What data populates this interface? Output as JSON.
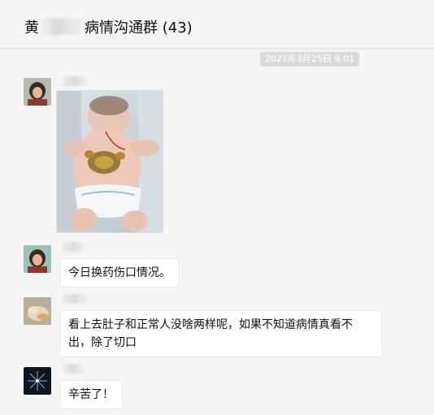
{
  "header": {
    "title_prefix": "黄",
    "title_suffix": "病情沟通群 (43)"
  },
  "timestamp": "2021年3月25日 9:01",
  "messages": [
    {
      "type": "image",
      "alt_icon": "baby-photo"
    },
    {
      "type": "text",
      "text": "今日换药伤口情况。"
    },
    {
      "type": "text",
      "text": "看上去肚子和正常人没啥两样呢，如果不知道病情真看不出，除了切口"
    },
    {
      "type": "text",
      "text": "辛苦了！"
    }
  ],
  "colors": {
    "background": "#f5f5f5",
    "bubble": "#ffffff",
    "timestamp_bg": "#dadada"
  }
}
